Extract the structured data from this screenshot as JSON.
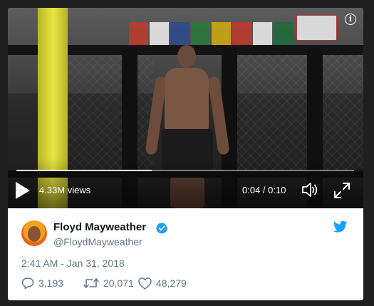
{
  "video": {
    "views": "4.33M views",
    "time": "0:04 / 0:10",
    "progress": 0.4
  },
  "tweet": {
    "display_name": "Floyd Mayweather",
    "handle": "@FloydMayweather",
    "timestamp": "2:41 AM - Jan 31, 2018",
    "replies": "3,193",
    "retweets": "20,071",
    "likes": "48,279"
  },
  "colors": {
    "verified": "#1da1f2",
    "twitter_brand": "#1da1f2",
    "name_text": "#14171a",
    "meta_text": "#657786"
  },
  "icons": [
    "info-icon",
    "play-icon",
    "volume-icon",
    "fullscreen-icon",
    "verified-icon",
    "twitter-bird-icon",
    "reply-icon",
    "retweet-icon",
    "like-icon"
  ]
}
